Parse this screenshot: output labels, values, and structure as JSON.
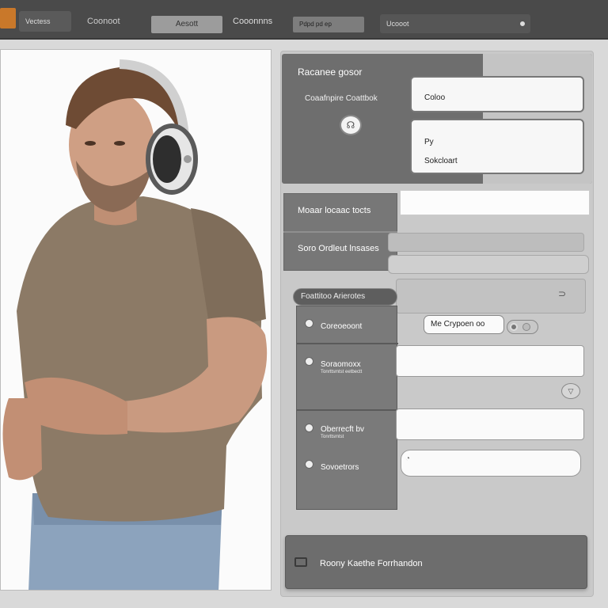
{
  "colors": {
    "topbar": "#4a4a4a",
    "logo_accent": "#c9782a",
    "panel_dark": "#6e6e6e",
    "panel_light": "#c9c9c9",
    "field_white": "#f7f7f7"
  },
  "topbar": {
    "logo_icon": "logo-icon",
    "tabs": [
      "Vectess",
      "Coonoot",
      "Aesott",
      "Cooonnns",
      "Pdpd pd ep",
      "Ucooot"
    ],
    "tab6_icon": "radio-icon"
  },
  "photo": {
    "subject": "man-with-headphones"
  },
  "card_top": {
    "title": "Racanee gosor",
    "subtitle": "Coaafnpire Coattbok",
    "icon": "headset-icon",
    "field1_label": "Coloo",
    "field2_line1": "Py",
    "field2_line2": "Sokcloart"
  },
  "menu": {
    "title": "Moaar locaac tocts",
    "subtitle": "Soro Ordleut lnsases"
  },
  "dropdown": {
    "header": "Foattitoo Arierotes",
    "items": [
      {
        "label": "Coreoeoont",
        "tiny": ""
      },
      {
        "label": "Soraomoxx",
        "tiny": "Tonrttsmtst eetbectt"
      },
      {
        "label": "Oberrecft bv",
        "tiny": "Tonrttsmtst"
      },
      {
        "label": "Sovoetrors",
        "tiny": ""
      }
    ]
  },
  "inputs": {
    "pill_value": "Me Crypoen oo",
    "chevron_icon": "chevron-down-icon",
    "search_icon": "search-icon"
  },
  "bottom": {
    "label": "Roony Kaethe Forrhandon",
    "icon": "folder-icon"
  }
}
